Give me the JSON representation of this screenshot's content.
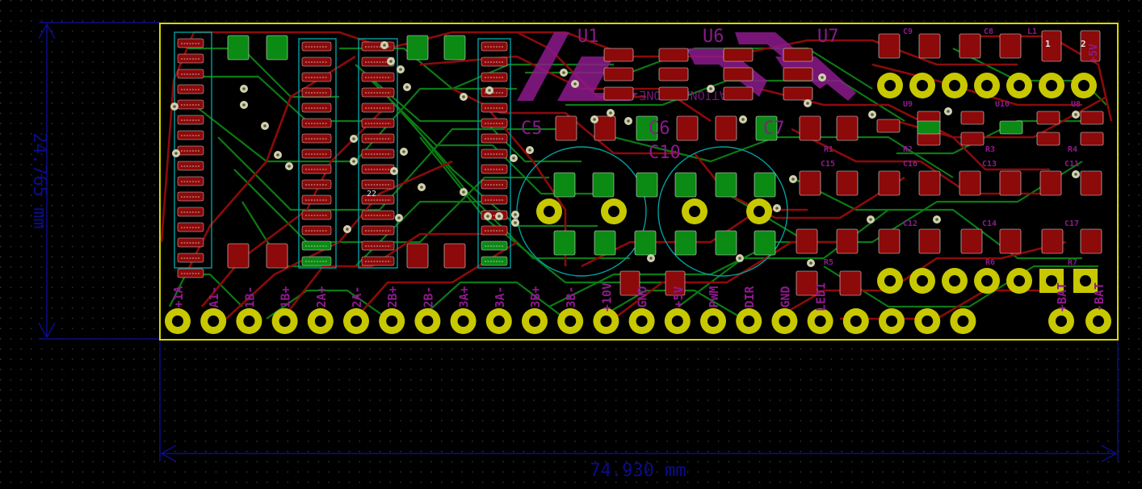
{
  "dimensions": {
    "height_label": "24.765 mm",
    "width_label": "74.930 mm"
  },
  "silkscreen_refs": {
    "regulators": [
      "U1",
      "U6",
      "U7"
    ],
    "caps_large": [
      "C5",
      "C6",
      "C7",
      "C10"
    ],
    "caps_right_top": [
      "C8",
      "C9"
    ],
    "caps_right_mid": [
      "C15",
      "C16",
      "C13",
      "C11"
    ],
    "caps_right_low": [
      "C12",
      "C14",
      "C17"
    ],
    "ics_right": [
      "U9",
      "U10",
      "U8"
    ],
    "resistors_right": [
      "R1",
      "R2",
      "R3",
      "R4",
      "R5",
      "R6",
      "R7"
    ],
    "inductors": [
      "L1"
    ],
    "ic_left": [
      "22"
    ],
    "logo_text": "NATIONAL TONE"
  },
  "pin_labels": {
    "bottom_row": [
      "+1A",
      "A1-",
      "1B-",
      "1B+",
      "2A+",
      "2A-",
      "2B+",
      "2B-",
      "3A+",
      "3A-",
      "3B+",
      "3B-",
      "+10V",
      "GND",
      "+5V",
      "PWM",
      "DIR",
      "GND",
      "LED1",
      "",
      "",
      "",
      "",
      "+BAT",
      "-BAT"
    ],
    "top_right": [
      "+5V",
      "2",
      "1"
    ],
    "mid_row": [
      "",
      "",
      "",
      "",
      "",
      "+2",
      "+1"
    ]
  },
  "colors": {
    "background": "#000000",
    "grid_dot": "#3a3a3a",
    "board_outline": "#d8d800",
    "dimension": "#0c0c8a",
    "copper_front": "#8c0a0a",
    "copper_back": "#0b7a14",
    "pad_front": "#8c0a0a",
    "pad_back": "#0b8a14",
    "pad_tht": "#c8c800",
    "silk": "#8c1a8c",
    "via": "#d0d0b0",
    "courtyard": "#00a0a0",
    "fab": "#c0c0c0"
  }
}
